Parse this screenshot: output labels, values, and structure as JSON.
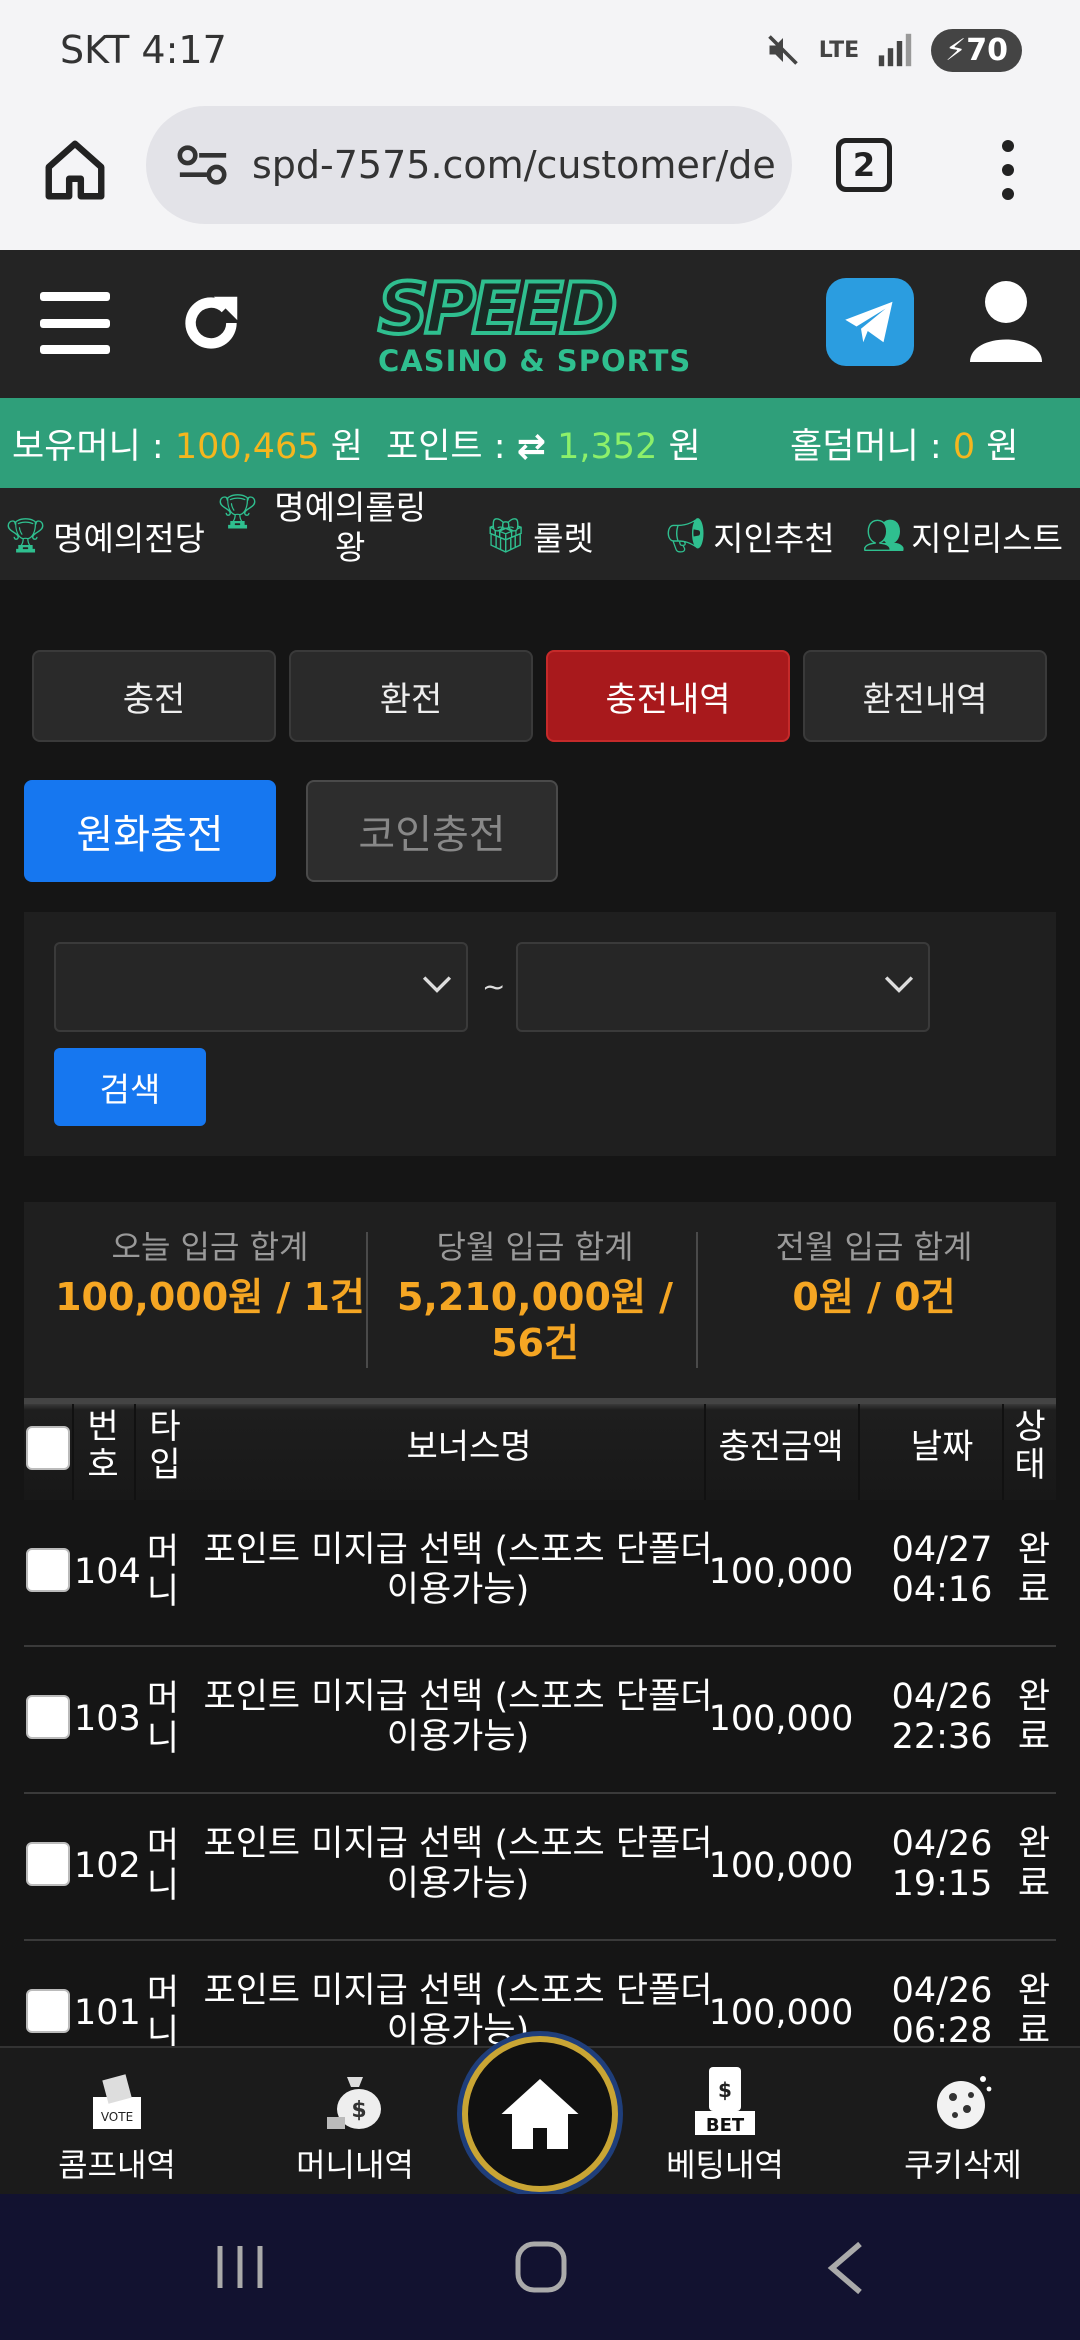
{
  "status": {
    "carrier": "SKT",
    "time": "4:17",
    "network": "LTE",
    "battery": "70"
  },
  "browser": {
    "url": "spd-7575.com/customer/de",
    "tab_count": "2"
  },
  "logo": {
    "main": "SPEED",
    "sub": "CASINO & SPORTS"
  },
  "balances": {
    "money_label": "보유머니 :",
    "money_value": "100,465",
    "money_unit": "원",
    "point_label": "포인트 :",
    "point_value": "1,352",
    "point_unit": "원",
    "holdem_label": "홀덤머니 :",
    "holdem_value": "0",
    "holdem_unit": "원"
  },
  "menu": {
    "hall_of_fame": "명예의전당",
    "rolling_king": "명예의롤링왕",
    "roulette": "룰렛",
    "referral": "지인추천",
    "referral_list": "지인리스트"
  },
  "tabs": {
    "deposit": "충전",
    "withdraw": "환전",
    "deposit_history": "충전내역",
    "withdraw_history": "환전내역"
  },
  "subtabs": {
    "krw": "원화충전",
    "coin": "코인충전"
  },
  "filter": {
    "separator": "~",
    "search": "검색"
  },
  "summary": {
    "today_label": "오늘 입금 합계",
    "today_value": "100,000원 / 1건",
    "month_label": "당월 입금 합계",
    "month_value": "5,210,000원 / 56건",
    "lastmonth_label": "전월 입금 합계",
    "lastmonth_value": "0원 / 0건"
  },
  "table": {
    "headers": {
      "no": "번호",
      "type": "타입",
      "bonus": "보너스명",
      "amount": "충전금액",
      "date": "날짜",
      "status": "상태"
    },
    "rows": [
      {
        "no": "104",
        "type": "머니",
        "bonus": "포인트 미지급 선택 (스포츠 단폴더 이용가능)",
        "amount": "100,000",
        "date": "04/27",
        "time": "04:16",
        "status": "완료"
      },
      {
        "no": "103",
        "type": "머니",
        "bonus": "포인트 미지급 선택 (스포츠 단폴더 이용가능)",
        "amount": "100,000",
        "date": "04/26",
        "time": "22:36",
        "status": "완료"
      },
      {
        "no": "102",
        "type": "머니",
        "bonus": "포인트 미지급 선택 (스포츠 단폴더 이용가능)",
        "amount": "100,000",
        "date": "04/26",
        "time": "19:15",
        "status": "완료"
      },
      {
        "no": "101",
        "type": "머니",
        "bonus": "포인트 미지급 선택 (스포츠 단폴더 이용가능)",
        "amount": "100,000",
        "date": "04/26",
        "time": "06:28",
        "status": "완료"
      }
    ]
  },
  "bottom_nav": {
    "comp": "콤프내역",
    "money": "머니내역",
    "betting": "베팅내역",
    "cookie": "쿠키삭제",
    "bet_badge": "BET",
    "vote_badge": "VOTE"
  },
  "colors": {
    "accent_green": "#2fbf8f",
    "money_bar": "#2f9f7a",
    "active_tab": "#a8191c",
    "primary_blue": "#1677f0",
    "orange": "#f5a623"
  }
}
